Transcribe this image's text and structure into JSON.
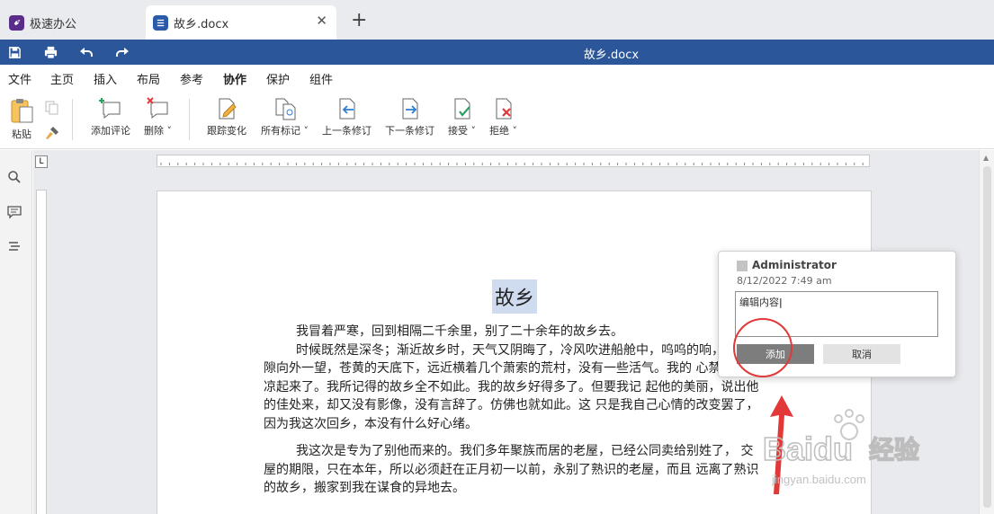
{
  "tabs": {
    "home_label": "极速办公",
    "doc_label": "故乡.docx",
    "close_symbol": "✕",
    "new_symbol": "+"
  },
  "titlebar": {
    "title": "故乡.docx"
  },
  "menu": {
    "items": [
      "文件",
      "主页",
      "插入",
      "布局",
      "参考",
      "协作",
      "保护",
      "组件"
    ],
    "active": "协作"
  },
  "ribbon": {
    "paste": "粘贴",
    "add_comment": "添加评论",
    "delete": "删除",
    "track_changes": "跟踪变化",
    "all_markup": "所有标记",
    "prev_change": "上一条修订",
    "next_change": "下一条修订",
    "accept": "接受",
    "reject": "拒绝"
  },
  "ruler": {
    "corner": "L"
  },
  "document": {
    "heading": "故乡",
    "paragraphs": [
      "我冒着严寒，回到相隔二千余里，别了二十余年的故乡去。",
      "时候既然是深冬；渐近故乡时，天气又阴晦了，冷风吹进船舱中，呜呜的响，从 篷隙向外一望，苍黄的天底下，远近横着几个萧索的荒村，没有一些活气。我的 心禁不住悲凉起来了。我所记得的故乡全不如此。我的故乡好得多了。但要我记 起他的美丽，说出他的佳处来，却又没有影像，没有言辞了。仿佛也就如此。这 只是我自己心情的改变罢了，因为我这次回乡，本没有什么好心绪。",
      "我这次是专为了别他而来的。我们多年聚族而居的老屋，已经公同卖给别姓了， 交屋的期限，只在本年，所以必须赶在正月初一以前，永别了熟识的老屋，而且 远离了熟识的故乡，搬家到我在谋食的异地去。"
    ]
  },
  "comment": {
    "author": "Administrator",
    "date": "8/12/2022 7:49 am",
    "text": "编辑内容",
    "add_button": "添加",
    "cancel_button": "取消"
  },
  "watermark": {
    "brand": "Baidu",
    "brand_cn": "经验",
    "url": "jingyan.baidu.com"
  },
  "colors": {
    "title_bar": "#2b579a",
    "accent": "#2b579a",
    "annotation": "#e23838",
    "heading_highlight": "#cfdcf0"
  }
}
